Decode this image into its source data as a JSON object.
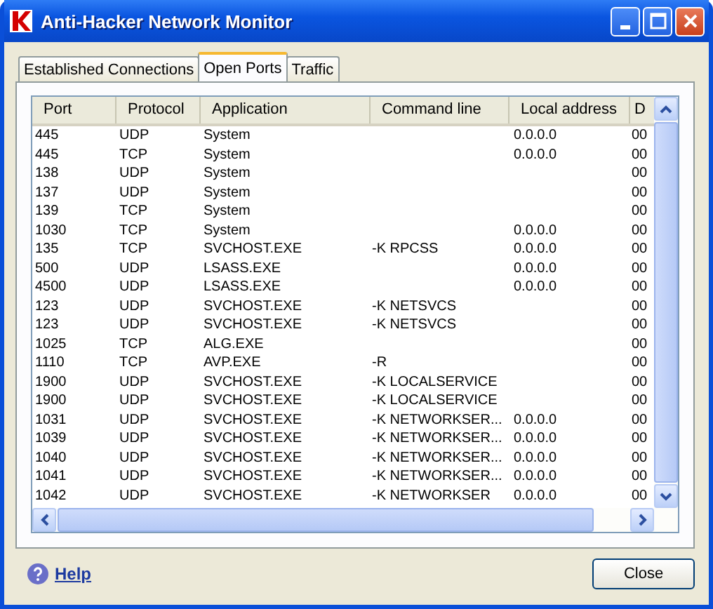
{
  "window": {
    "title": "Anti-Hacker Network Monitor"
  },
  "tabs": [
    {
      "label": "Established Connections",
      "selected": false
    },
    {
      "label": "Open Ports",
      "selected": true
    },
    {
      "label": "Traffic",
      "selected": false
    }
  ],
  "table": {
    "columns": [
      "Port",
      "Protocol",
      "Application",
      "Command line",
      "Local address",
      "D"
    ],
    "rows": [
      [
        "445",
        "UDP",
        "System",
        "",
        "0.0.0.0",
        "00"
      ],
      [
        "445",
        "TCP",
        "System",
        "",
        "0.0.0.0",
        "00"
      ],
      [
        "138",
        "UDP",
        "System",
        "",
        "",
        "00"
      ],
      [
        "137",
        "UDP",
        "System",
        "",
        "",
        "00"
      ],
      [
        "139",
        "TCP",
        "System",
        "",
        "",
        "00"
      ],
      [
        "1030",
        "TCP",
        "System",
        "",
        "0.0.0.0",
        "00"
      ],
      [
        "135",
        "TCP",
        "SVCHOST.EXE",
        "-K RPCSS",
        "0.0.0.0",
        "00"
      ],
      [
        "500",
        "UDP",
        "LSASS.EXE",
        "",
        "0.0.0.0",
        "00"
      ],
      [
        "4500",
        "UDP",
        "LSASS.EXE",
        "",
        "0.0.0.0",
        "00"
      ],
      [
        "123",
        "UDP",
        "SVCHOST.EXE",
        "-K NETSVCS",
        "",
        "00"
      ],
      [
        "123",
        "UDP",
        "SVCHOST.EXE",
        "-K NETSVCS",
        "",
        "00"
      ],
      [
        "1025",
        "TCP",
        "ALG.EXE",
        "",
        "",
        "00"
      ],
      [
        "1110",
        "TCP",
        "AVP.EXE",
        "-R",
        "",
        "00"
      ],
      [
        "1900",
        "UDP",
        "SVCHOST.EXE",
        "-K LOCALSERVICE",
        "",
        "00"
      ],
      [
        "1900",
        "UDP",
        "SVCHOST.EXE",
        "-K LOCALSERVICE",
        "",
        "00"
      ],
      [
        "1031",
        "UDP",
        "SVCHOST.EXE",
        "-K NETWORKSER...",
        "0.0.0.0",
        "00"
      ],
      [
        "1039",
        "UDP",
        "SVCHOST.EXE",
        "-K NETWORKSER...",
        "0.0.0.0",
        "00"
      ],
      [
        "1040",
        "UDP",
        "SVCHOST.EXE",
        "-K NETWORKSER...",
        "0.0.0.0",
        "00"
      ],
      [
        "1041",
        "UDP",
        "SVCHOST.EXE",
        "-K NETWORKSER...",
        "0.0.0.0",
        "00"
      ],
      [
        "1042",
        "UDP",
        "SVCHOST.EXE",
        "-K NETWORKSER",
        "0.0.0.0",
        "00"
      ]
    ]
  },
  "footer": {
    "help_link": "Help",
    "close_button": "Close"
  }
}
